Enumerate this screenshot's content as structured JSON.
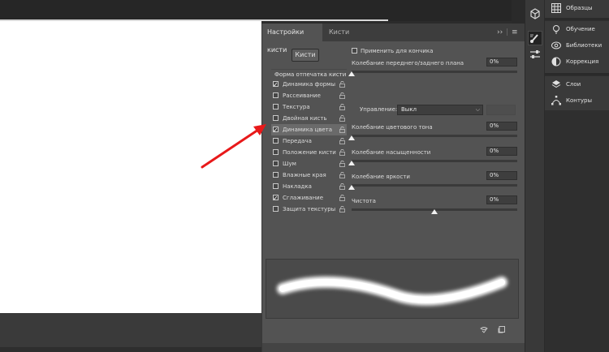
{
  "panel": {
    "tabs": [
      "Настройки кисти",
      "Кисти"
    ],
    "brushes_button": "Кисти",
    "left_list": {
      "header": "Форма отпечатка кисти",
      "items": [
        {
          "label": "Динамика формы",
          "checked": true
        },
        {
          "label": "Рассеивание",
          "checked": false
        },
        {
          "label": "Текстура",
          "checked": false
        },
        {
          "label": "Двойная кисть",
          "checked": false
        },
        {
          "label": "Динамика цвета",
          "checked": true
        },
        {
          "label": "Передача",
          "checked": false
        },
        {
          "label": "Положение кисти",
          "checked": false
        },
        {
          "label": "Шум",
          "checked": false
        },
        {
          "label": "Влажные края",
          "checked": false
        },
        {
          "label": "Накладка",
          "checked": false
        },
        {
          "label": "Сглаживание",
          "checked": true
        },
        {
          "label": "Защита текстуры",
          "checked": false
        }
      ]
    },
    "apply_per_tip": "Применить для кончика",
    "sliders": [
      {
        "label": "Колебание переднего/заднего плана",
        "value": "0%",
        "fraction": 0
      },
      {
        "label": "Колебание цветового тона",
        "value": "0%",
        "fraction": 0
      },
      {
        "label": "Колебание насыщенности",
        "value": "0%",
        "fraction": 0
      },
      {
        "label": "Колебание яркости",
        "value": "0%",
        "fraction": 0
      },
      {
        "label": "Чистота",
        "value": "0%",
        "fraction": 0.5
      }
    ],
    "control": {
      "label": "Управление:",
      "value": "Выкл"
    }
  },
  "right_panel": {
    "group1": [
      "Образцы"
    ],
    "group2": [
      "Обучение",
      "Библиотеки",
      "Коррекция"
    ],
    "group3": [
      "Слои",
      "Контуры"
    ]
  },
  "colors": {
    "annotation_arrow": "#e8191a",
    "panel_bg": "#535353"
  }
}
